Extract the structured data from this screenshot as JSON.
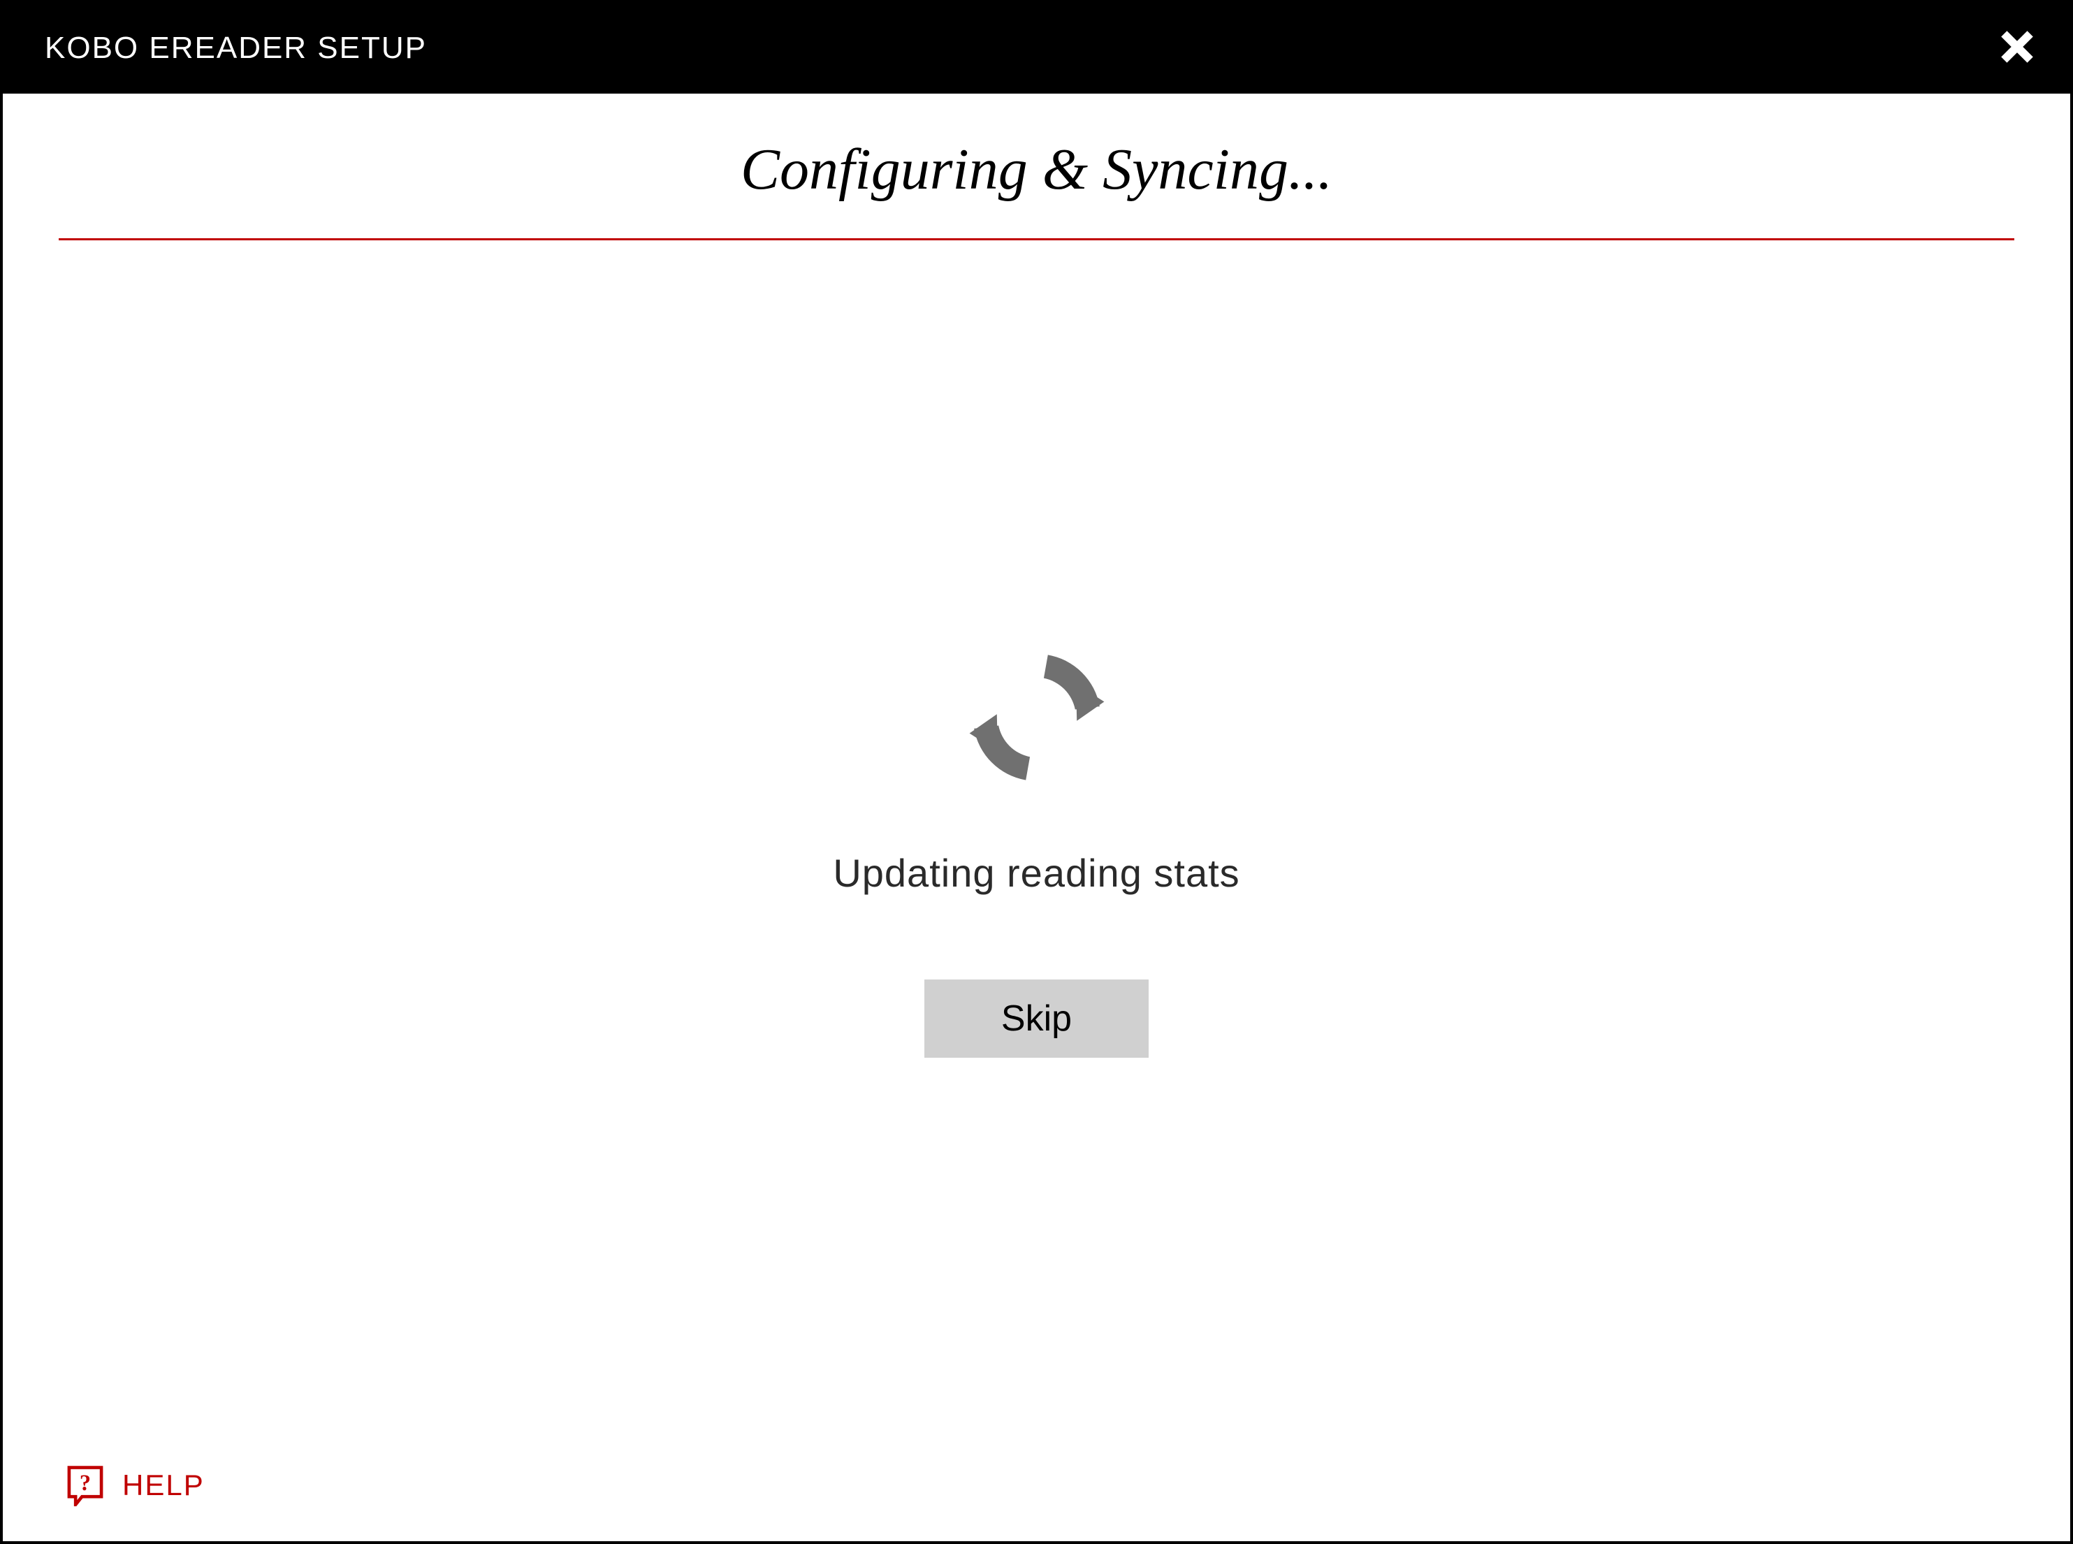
{
  "titlebar": {
    "title": "KOBO EREADER SETUP"
  },
  "main": {
    "heading": "Configuring & Syncing...",
    "status": "Updating reading stats",
    "skip_label": "Skip"
  },
  "footer": {
    "help_label": "HELP"
  },
  "colors": {
    "accent": "#c00000",
    "titlebar_bg": "#000000",
    "button_bg": "#d0d0d0",
    "icon_grey": "#707070"
  }
}
